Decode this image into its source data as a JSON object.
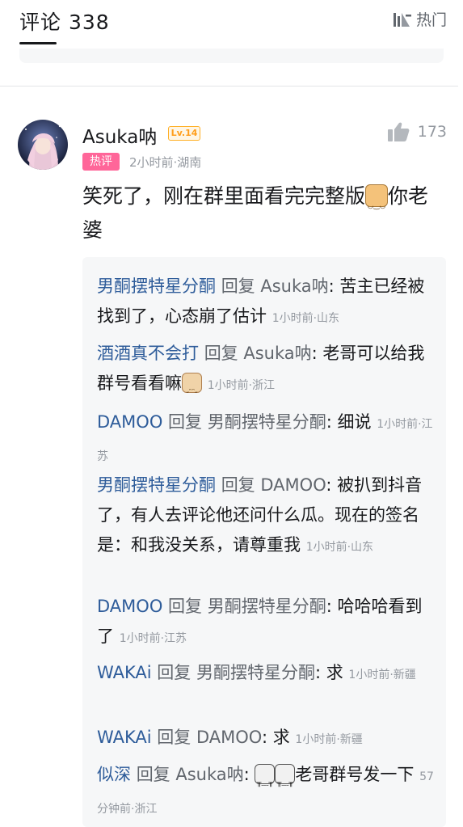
{
  "header": {
    "title": "评论 338",
    "sort_label": "热门"
  },
  "comment": {
    "user": "Asuka呐",
    "level": "Lv.14",
    "likes": "173",
    "badge": "热评",
    "meta": "2小时前·湖南",
    "text1": "笑死了，刚在群里面看完完整版",
    "text2": "你老婆"
  },
  "replies": [
    {
      "user": "男酮摆特星分酮",
      "reply_word": "回复",
      "target": "Asuka呐",
      "text": ": 苦主已经被找到了，心态崩了估计",
      "meta": "1小时前·山东"
    },
    {
      "user": "酒酒真不会打",
      "reply_word": "回复",
      "target": "Asuka呐",
      "text": ": 老哥可以给我群号看看嘛",
      "meta": "1小时前·浙江"
    },
    {
      "user": "DAMOO",
      "reply_word": "回复",
      "target": "男酮摆特星分酮",
      "text": ": 细说",
      "meta": "1小时前·江苏"
    },
    {
      "user": "男酮摆特星分酮",
      "reply_word": "回复",
      "target": "DAMOO",
      "text": ": 被扒到抖音了，有人去评论他还问什么瓜。现在的签名是：和我没关系，请尊重我",
      "meta": "1小时前·山东"
    },
    {
      "user": "DAMOO",
      "reply_word": "回复",
      "target": "男酮摆特星分酮",
      "text": ": 哈哈哈看到了",
      "meta": "1小时前·江苏"
    },
    {
      "user": "WAKAi",
      "reply_word": "回复",
      "target": "男酮摆特星分酮",
      "text": ": 求",
      "meta": "1小时前·新疆"
    },
    {
      "user": "WAKAi",
      "reply_word": "回复",
      "target": "DAMOO",
      "text": ": 求",
      "meta": "1小时前·新疆"
    },
    {
      "user": "似深",
      "reply_word": "回复",
      "target": "Asuka呐",
      "text_pre": ":",
      "text": "老哥群号发一下",
      "meta": "57分钟前·浙江"
    }
  ],
  "icons": {
    "sort": "sort-bars-icon",
    "like": "thumbs-up-icon",
    "emoji_cat": "cat-face-emoji",
    "emoji_cow": "cow-face-emoji",
    "emoji_sob": "crying-face-emoji"
  },
  "colors": {
    "accent_username": "#2e5c9a",
    "hot_badge": "#ff6699",
    "level_badge": "#ff9e1b",
    "meta": "#9499a0",
    "reply_bg": "#f6f7f8"
  }
}
